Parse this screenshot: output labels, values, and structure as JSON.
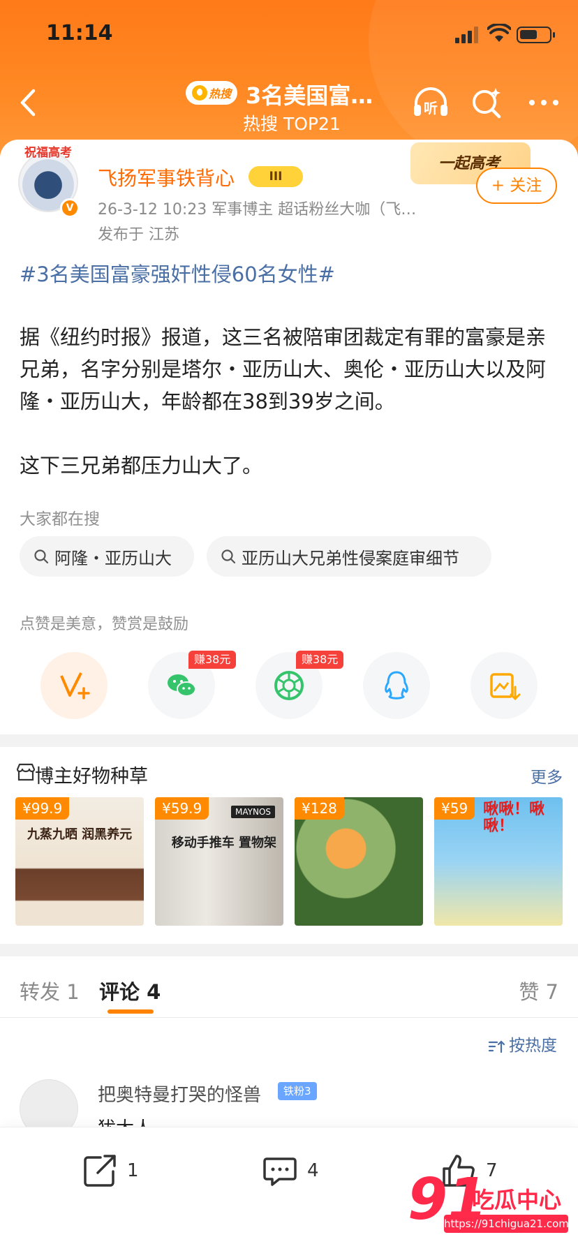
{
  "status_bar": {
    "time": "11:14"
  },
  "header": {
    "hot_badge": "热搜",
    "title": "3名美国富…",
    "subtitle": "热搜 TOP21",
    "listen_icon": "listen-headphones-icon",
    "search_icon": "search-sparkle-icon",
    "more_icon": "more-dots-icon"
  },
  "post": {
    "author": "飞扬军事铁背心",
    "avatar_banner": "祝福高考",
    "rank_badge": "III",
    "meta": "26-3-12 10:23  军事博主 超话粉丝大咖（飞…",
    "location": "发布于 江苏",
    "promo_banner": "一起高考",
    "follow_label": "+ 关注",
    "hashtag": "#3名美国富豪强奸性侵60名女性#",
    "body_lines": [
      "据《纽约时报》报道，这三名被陪审团裁定有罪的富豪是亲兄弟，名字分别是塔尔・亚历山大、奥伦・亚历山大以及阿隆・亚历山大，年龄都在38到39岁之间。",
      "这下三兄弟都压力山大了。"
    ]
  },
  "related_search": {
    "label": "大家都在搜",
    "chips": [
      "阿隆・亚历山大",
      "亚历山大兄弟性侵案庭审细节"
    ]
  },
  "share": {
    "label": "点赞是美意，赞赏是鼓励",
    "earn_tags": [
      "赚38元",
      "赚38元"
    ],
    "icons": [
      "reward-v-plus-icon",
      "wechat-icon",
      "moments-icon",
      "qq-icon",
      "save-image-icon"
    ]
  },
  "goods": {
    "title": "博主好物种草",
    "more": "更多",
    "items": [
      {
        "price": "¥99.9",
        "text": "九蒸九晒 润黑养元"
      },
      {
        "price": "¥59.9",
        "brand": "MAYNOS",
        "text": "移动手推车 置物架"
      },
      {
        "price": "¥128",
        "text": ""
      },
      {
        "price": "¥59",
        "text": "啾啾！啾啾！"
      }
    ]
  },
  "tabs": {
    "repost": "转发 1",
    "comment": "评论 4",
    "like": "赞 7"
  },
  "sort": {
    "label": "按热度"
  },
  "comment": {
    "name": "把奥特曼打哭的怪兽",
    "fan_badge": "铁粉3",
    "text": "犹太人"
  },
  "bottom_bar": {
    "repost_count": "1",
    "comment_count": "4",
    "like_count": "7"
  },
  "watermark": {
    "big": "91",
    "cn": "吃瓜中心",
    "url": "https://91chigua21.com/"
  },
  "colors": {
    "accent": "#ff8200",
    "header_bg": "#ff7a18",
    "link": "#4a6fa5",
    "earn_red": "#f6413b"
  }
}
